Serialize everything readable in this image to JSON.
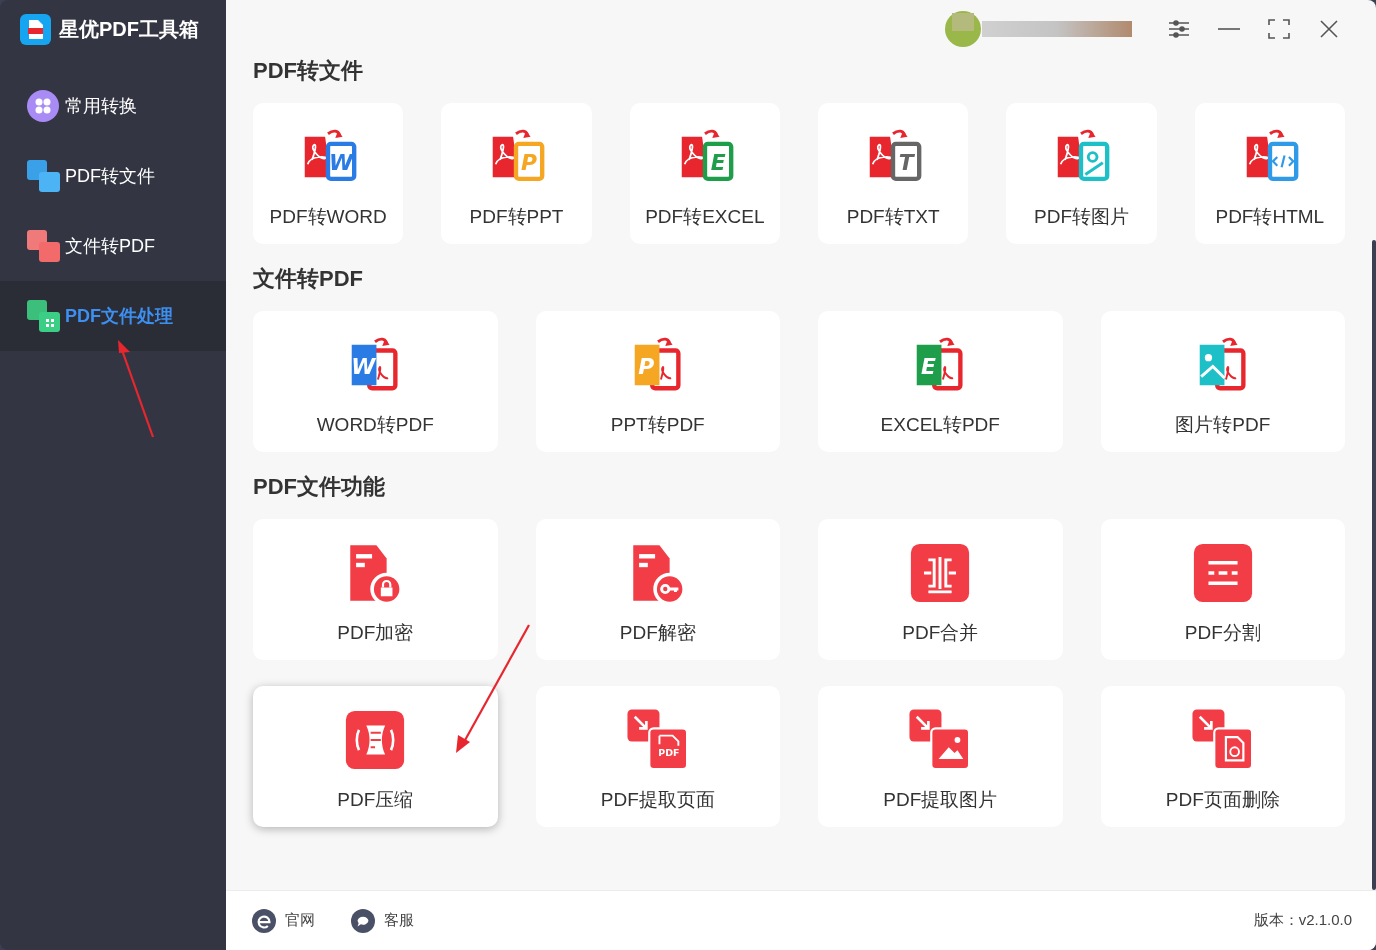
{
  "app": {
    "title": "星优PDF工具箱"
  },
  "sidebar": {
    "items": [
      {
        "label": "常用转换",
        "kind": "common",
        "selected": false
      },
      {
        "label": "PDF转文件",
        "kind": "pdf-to-file",
        "selected": false
      },
      {
        "label": "文件转PDF",
        "kind": "file-to-pdf",
        "selected": false
      },
      {
        "label": "PDF文件处理",
        "kind": "process",
        "selected": true
      }
    ]
  },
  "sections": [
    {
      "title": "PDF转文件",
      "tools": [
        {
          "label": "PDF转WORD",
          "kind": "to-doc",
          "glyph": "W",
          "color": "#2b7be5",
          "selected": false
        },
        {
          "label": "PDF转PPT",
          "kind": "to-doc",
          "glyph": "P",
          "color": "#f5a623",
          "selected": false
        },
        {
          "label": "PDF转EXCEL",
          "kind": "to-doc",
          "glyph": "E",
          "color": "#1e9e4a",
          "selected": false
        },
        {
          "label": "PDF转TXT",
          "kind": "to-doc",
          "glyph": "T",
          "color": "#666666",
          "selected": false
        },
        {
          "label": "PDF转图片",
          "kind": "to-image",
          "color": "#1ec0c8",
          "selected": false
        },
        {
          "label": "PDF转HTML",
          "kind": "to-code",
          "color": "#2f9be8",
          "selected": false
        }
      ]
    },
    {
      "title": "文件转PDF",
      "tools": [
        {
          "label": "WORD转PDF",
          "kind": "from-doc",
          "glyph": "W",
          "color": "#2b7be5",
          "selected": false
        },
        {
          "label": "PPT转PDF",
          "kind": "from-doc",
          "glyph": "P",
          "color": "#f5a623",
          "selected": false
        },
        {
          "label": "EXCEL转PDF",
          "kind": "from-doc",
          "glyph": "E",
          "color": "#1e9e4a",
          "selected": false
        },
        {
          "label": "图片转PDF",
          "kind": "from-image",
          "color": "#1ec0c8",
          "selected": false
        }
      ]
    },
    {
      "title": "PDF文件功能",
      "tools": [
        {
          "label": "PDF加密",
          "kind": "encrypt",
          "selected": false
        },
        {
          "label": "PDF解密",
          "kind": "decrypt",
          "selected": false
        },
        {
          "label": "PDF合并",
          "kind": "merge",
          "selected": false
        },
        {
          "label": "PDF分割",
          "kind": "split",
          "selected": false
        },
        {
          "label": "PDF压缩",
          "kind": "compress",
          "selected": true
        },
        {
          "label": "PDF提取页面",
          "kind": "extract-pages",
          "glyph": "PDF",
          "selected": false
        },
        {
          "label": "PDF提取图片",
          "kind": "extract-images",
          "selected": false
        },
        {
          "label": "PDF页面删除",
          "kind": "delete-pages",
          "selected": false
        }
      ]
    }
  ],
  "footer": {
    "links": [
      {
        "label": "官网",
        "kind": "web"
      },
      {
        "label": "客服",
        "kind": "chat"
      }
    ],
    "version": "版本：v2.1.0.0"
  }
}
